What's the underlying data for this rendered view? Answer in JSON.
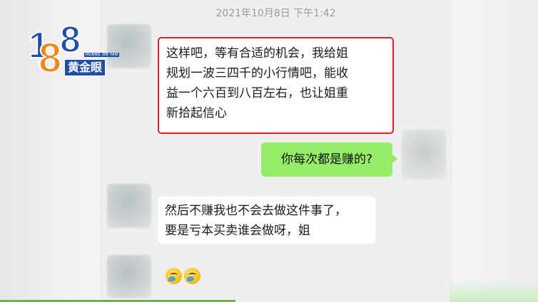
{
  "chat": {
    "timestamp": "2021年10月8日 下午1:42",
    "messages": [
      {
        "side": "left",
        "highlighted": true,
        "lines": [
          "这样吧，等有合适的机会，我给姐",
          "规划一波三四千的小行情吧，能收",
          "益一个六百到八百左右，也让姐重",
          "新拾起信心"
        ]
      },
      {
        "side": "right",
        "text": "你每次都是赚的?"
      },
      {
        "side": "left",
        "lines": [
          "然后不赚我也不会去做这件事了，",
          "要是亏本买卖谁会做呀，姐"
        ]
      },
      {
        "side": "left",
        "emojis": [
          "crying-laughing-emoji",
          "crying-laughing-emoji"
        ]
      }
    ]
  },
  "logo": {
    "digit1": "1",
    "digit2": "8",
    "digit3": "8",
    "subtitle": "HUANG JIN YAN",
    "name": "黄金眼"
  },
  "colors": {
    "highlight_border": "#d9202a",
    "sent_bubble": "#95ec69",
    "received_bubble": "#ffffff",
    "logo_blue": "#1f4fa8",
    "logo_orange": "#f08a1c"
  }
}
